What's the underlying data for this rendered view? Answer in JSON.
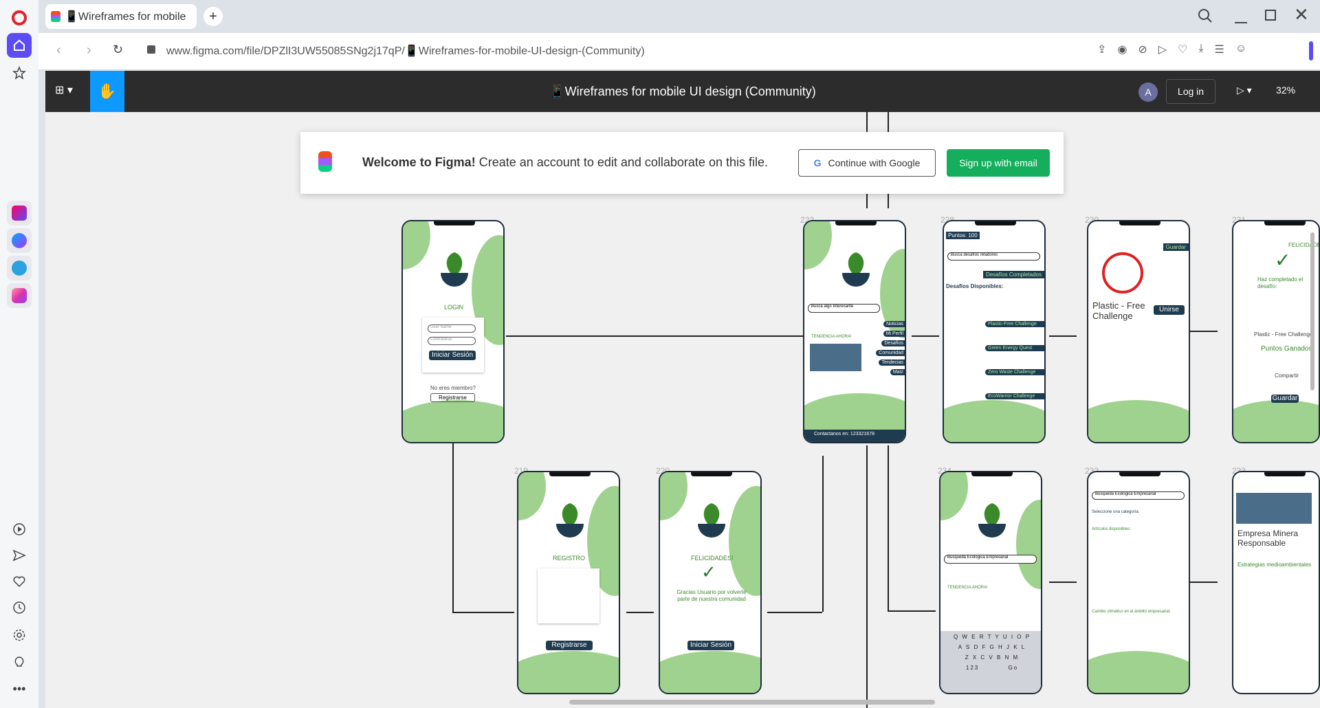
{
  "browser": {
    "tab_title": "📱Wireframes for mobile",
    "url": "www.figma.com/file/DPZlI3UW55085SNg2j17qP/📱Wireframes-for-mobile-UI-design-(Community)"
  },
  "figma": {
    "file_title": "📱Wireframes for mobile UI design (Community)",
    "avatar_letter": "A",
    "login_label": "Log in",
    "zoom": "32%"
  },
  "welcome": {
    "headline": "Welcome to Figma!",
    "message": "Create an account to edit and collaborate on this file.",
    "google_button": "Continue with Google",
    "email_button": "Sign up with email"
  },
  "frames": {
    "login": {
      "title": "LOGIN",
      "user_placeholder": "User Name",
      "pass_placeholder": "Contraseña",
      "login_button": "Iniciar Sesión",
      "not_member": "No eres miembro?",
      "register_button": "Registrarse"
    },
    "f222": {
      "num": "222",
      "search": "Busca algo Interesante",
      "trending": "TENDENCIA AHORA!",
      "menu": [
        "Noticias",
        "Mi Perfil",
        "Desafíos",
        "Comunidad",
        "Tendecias",
        "Mas!"
      ],
      "contact": "Contactanos en: 123321678"
    },
    "f228": {
      "num": "228",
      "points": "Puntos: 100",
      "search": "Busca desafíos retadores",
      "completed": "Desafíos Completados",
      "available": "Desafíos Disponibles:",
      "challenges": [
        "Plastic-Free Challenge",
        "Green Energy Quest",
        "Zero Waste Challenge",
        "EcoWarrior Challenge"
      ]
    },
    "f230": {
      "num": "230",
      "guardar": "Guardar",
      "title": "Plastic - Free Challenge",
      "join": "Unirse"
    },
    "f231": {
      "num": "231",
      "congrats": "FELICIDADES!",
      "text": "Haz completado el desafío:",
      "challenge": "Plastic - Free Challenge",
      "points": "Puntos Ganados",
      "share": "Compartir",
      "save": "Guardar"
    },
    "f219": {
      "num": "219",
      "title": "REGISTRO",
      "register_button": "Registrarse"
    },
    "f220": {
      "num": "220",
      "congrats": "FELICIDADES!",
      "text": "Gracias Usuario por volverte parte de nuestra comunidad",
      "login_button": "Iniciar Sesión"
    },
    "f234": {
      "num": "234",
      "search": "Busqueda Ecologica Empresarial",
      "trending": "TENDENCIA AHORA!",
      "keys": [
        "Q W E R T Y U I O P",
        "A S D F G H J K L",
        "Z X C V B N M",
        "123          Go"
      ]
    },
    "f232": {
      "num": "232",
      "search": "Busqueda Ecologica Empresarial",
      "category": "Seleccione una categoría:",
      "articles": "Artículos disponibles:",
      "climate": "Cambio climático en el ámbito empresarial:"
    },
    "f233": {
      "num": "233",
      "title": "Empresa Minera Responsable",
      "strategies": "Estrategias medioambientales"
    }
  }
}
